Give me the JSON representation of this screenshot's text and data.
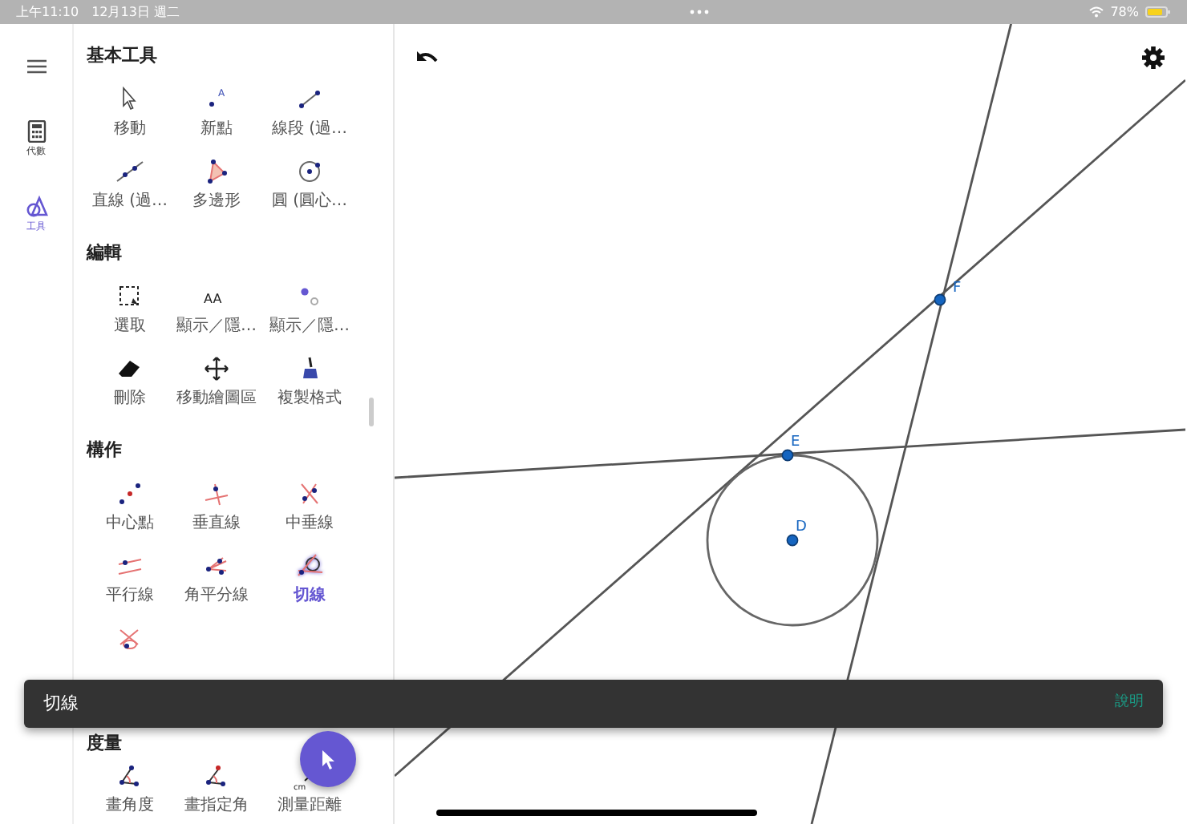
{
  "status_bar": {
    "time": "上午11:10",
    "date": "12月13日 週二",
    "battery": "78%"
  },
  "rail": [
    {
      "label": "代數",
      "selected": false
    },
    {
      "label": "工具",
      "selected": true
    }
  ],
  "sections": [
    {
      "title": "基本工具",
      "tools": [
        {
          "label": "移動",
          "selected": false
        },
        {
          "label": "新點",
          "selected": false,
          "icon_text": "A"
        },
        {
          "label": "線段 (過…",
          "selected": false
        },
        {
          "label": "直線 (過…",
          "selected": false
        },
        {
          "label": "多邊形",
          "selected": false
        },
        {
          "label": "圓 (圓心…",
          "selected": false
        }
      ]
    },
    {
      "title": "編輯",
      "tools": [
        {
          "label": "選取",
          "selected": false
        },
        {
          "label": "顯示／隱…",
          "selected": false,
          "icon_text": "AA"
        },
        {
          "label": "顯示／隱…",
          "selected": false
        },
        {
          "label": "刪除",
          "selected": false
        },
        {
          "label": "移動繪圖區",
          "selected": false
        },
        {
          "label": "複製格式",
          "selected": false
        }
      ]
    },
    {
      "title": "構作",
      "tools": [
        {
          "label": "中心點",
          "selected": false
        },
        {
          "label": "垂直線",
          "selected": false
        },
        {
          "label": "中垂線",
          "selected": false
        },
        {
          "label": "平行線",
          "selected": false
        },
        {
          "label": "角平分線",
          "selected": false
        },
        {
          "label": "切線",
          "selected": true
        },
        {
          "selected": false
        }
      ]
    },
    {
      "title": "度量",
      "tools": [
        {
          "label": "畫角度",
          "selected": false
        },
        {
          "label": "畫指定角",
          "selected": false
        },
        {
          "label": "測量距離",
          "selected": false,
          "icon_text": "cm"
        }
      ]
    }
  ],
  "points": [
    {
      "label": "E"
    },
    {
      "label": "D"
    },
    {
      "label": "F"
    }
  ],
  "snackbar": {
    "text": "切線",
    "action": "說明"
  }
}
